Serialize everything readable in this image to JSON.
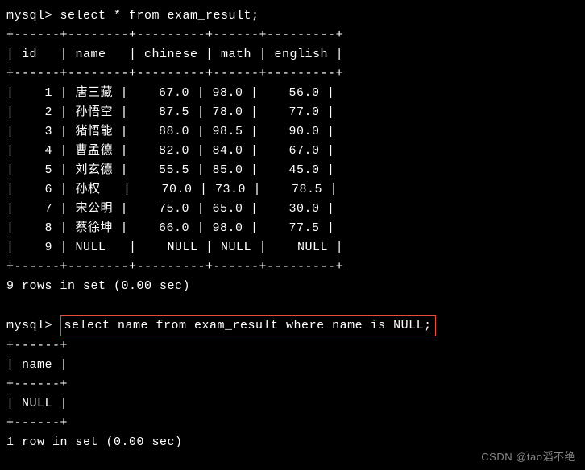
{
  "prompt": "mysql> ",
  "query1": "select * from exam_result;",
  "table1": {
    "sep": "+------+--------+---------+------+---------+",
    "header": "| id   | name   | chinese | math | english |",
    "rows": [
      "|    1 | 唐三藏 |    67.0 | 98.0 |    56.0 |",
      "|    2 | 孙悟空 |    87.5 | 78.0 |    77.0 |",
      "|    3 | 猪悟能 |    88.0 | 98.5 |    90.0 |",
      "|    4 | 曹孟德 |    82.0 | 84.0 |    67.0 |",
      "|    5 | 刘玄德 |    55.5 | 85.0 |    45.0 |",
      "|    6 | 孙权   |    70.0 | 73.0 |    78.5 |",
      "|    7 | 宋公明 |    75.0 | 65.0 |    30.0 |",
      "|    8 | 蔡徐坤 |    66.0 | 98.0 |    77.5 |",
      "|    9 | NULL   |    NULL | NULL |    NULL |"
    ],
    "footer": "9 rows in set (0.00 sec)"
  },
  "query2": "select name from exam_result where name is NULL;",
  "table2": {
    "sep": "+------+",
    "header": "| name |",
    "rows": [
      "| NULL |"
    ],
    "footer": "1 row in set (0.00 sec)"
  },
  "chart_data": {
    "type": "table",
    "title": "exam_result",
    "columns": [
      "id",
      "name",
      "chinese",
      "math",
      "english"
    ],
    "rows": [
      {
        "id": 1,
        "name": "唐三藏",
        "chinese": 67.0,
        "math": 98.0,
        "english": 56.0
      },
      {
        "id": 2,
        "name": "孙悟空",
        "chinese": 87.5,
        "math": 78.0,
        "english": 77.0
      },
      {
        "id": 3,
        "name": "猪悟能",
        "chinese": 88.0,
        "math": 98.5,
        "english": 90.0
      },
      {
        "id": 4,
        "name": "曹孟德",
        "chinese": 82.0,
        "math": 84.0,
        "english": 67.0
      },
      {
        "id": 5,
        "name": "刘玄德",
        "chinese": 55.5,
        "math": 85.0,
        "english": 45.0
      },
      {
        "id": 6,
        "name": "孙权",
        "chinese": 70.0,
        "math": 73.0,
        "english": 78.5
      },
      {
        "id": 7,
        "name": "宋公明",
        "chinese": 75.0,
        "math": 65.0,
        "english": 30.0
      },
      {
        "id": 8,
        "name": "蔡徐坤",
        "chinese": 66.0,
        "math": 98.0,
        "english": 77.5
      },
      {
        "id": 9,
        "name": null,
        "chinese": null,
        "math": null,
        "english": null
      }
    ]
  },
  "watermark": "CSDN @tao滔不绝"
}
